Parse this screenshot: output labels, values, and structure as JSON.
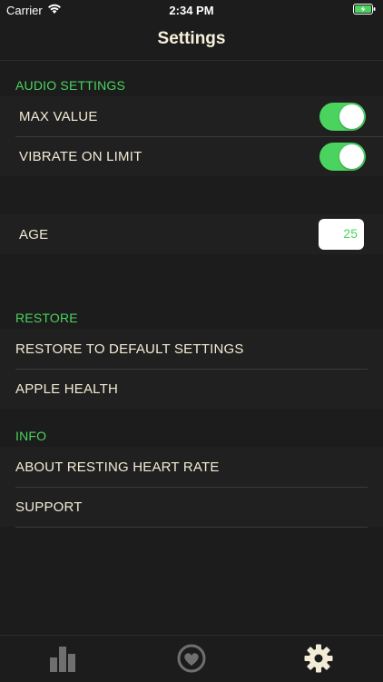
{
  "status_bar": {
    "carrier": "Carrier",
    "time": "2:34 PM",
    "wifi_icon": "wifi-icon",
    "battery_icon": "battery-charging-icon"
  },
  "nav": {
    "title": "Settings"
  },
  "colors": {
    "accent": "#4ad35f",
    "background": "#1c1c1c",
    "text": "#f2ecd6",
    "icon_inactive": "#6f6f6f"
  },
  "audio": {
    "header": "AUDIO SETTINGS",
    "max_value": {
      "label": "MAX VALUE",
      "on": true
    },
    "vibrate": {
      "label": "VIBRATE ON LIMIT",
      "on": true
    }
  },
  "age": {
    "label": "AGE",
    "value": "25"
  },
  "restore": {
    "header": "RESTORE",
    "default_label": "RESTORE TO DEFAULT SETTINGS",
    "health_label": "APPLE HEALTH"
  },
  "info": {
    "header": "INFO",
    "about_label": "ABOUT RESTING HEART RATE",
    "support_label": "SUPPORT"
  },
  "tabs": [
    {
      "icon": "bar-chart-icon",
      "active": false
    },
    {
      "icon": "heart-icon",
      "active": false
    },
    {
      "icon": "gear-icon",
      "active": true
    }
  ]
}
